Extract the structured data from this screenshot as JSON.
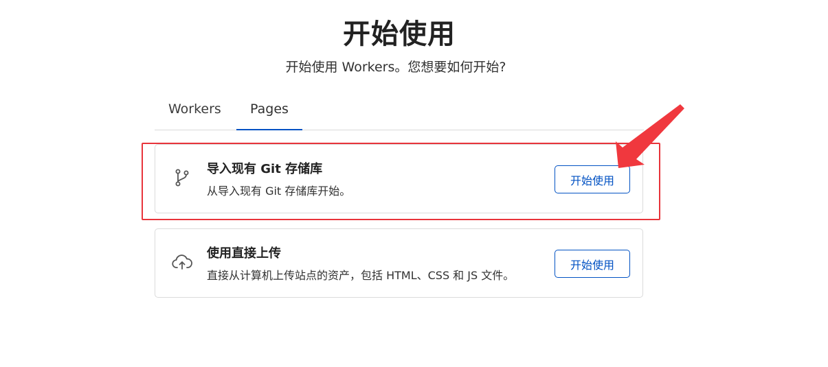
{
  "header": {
    "title": "开始使用",
    "subtitle": "开始使用 Workers。您想要如何开始?"
  },
  "tabs": [
    {
      "label": "Workers",
      "selected": false
    },
    {
      "label": "Pages",
      "selected": true
    }
  ],
  "cards": [
    {
      "icon": "git-branch-icon",
      "title": "导入现有 Git 存储库",
      "description": "从导入现有 Git 存储库开始。",
      "button_label": "开始使用"
    },
    {
      "icon": "cloud-upload-icon",
      "title": "使用直接上传",
      "description": "直接从计算机上传站点的资产，包括 HTML、CSS 和 JS 文件。",
      "button_label": "开始使用"
    }
  ],
  "colors": {
    "accent": "#0051c3",
    "annotation": "#e8333a",
    "title_text": "#222222",
    "border": "#dadada"
  }
}
